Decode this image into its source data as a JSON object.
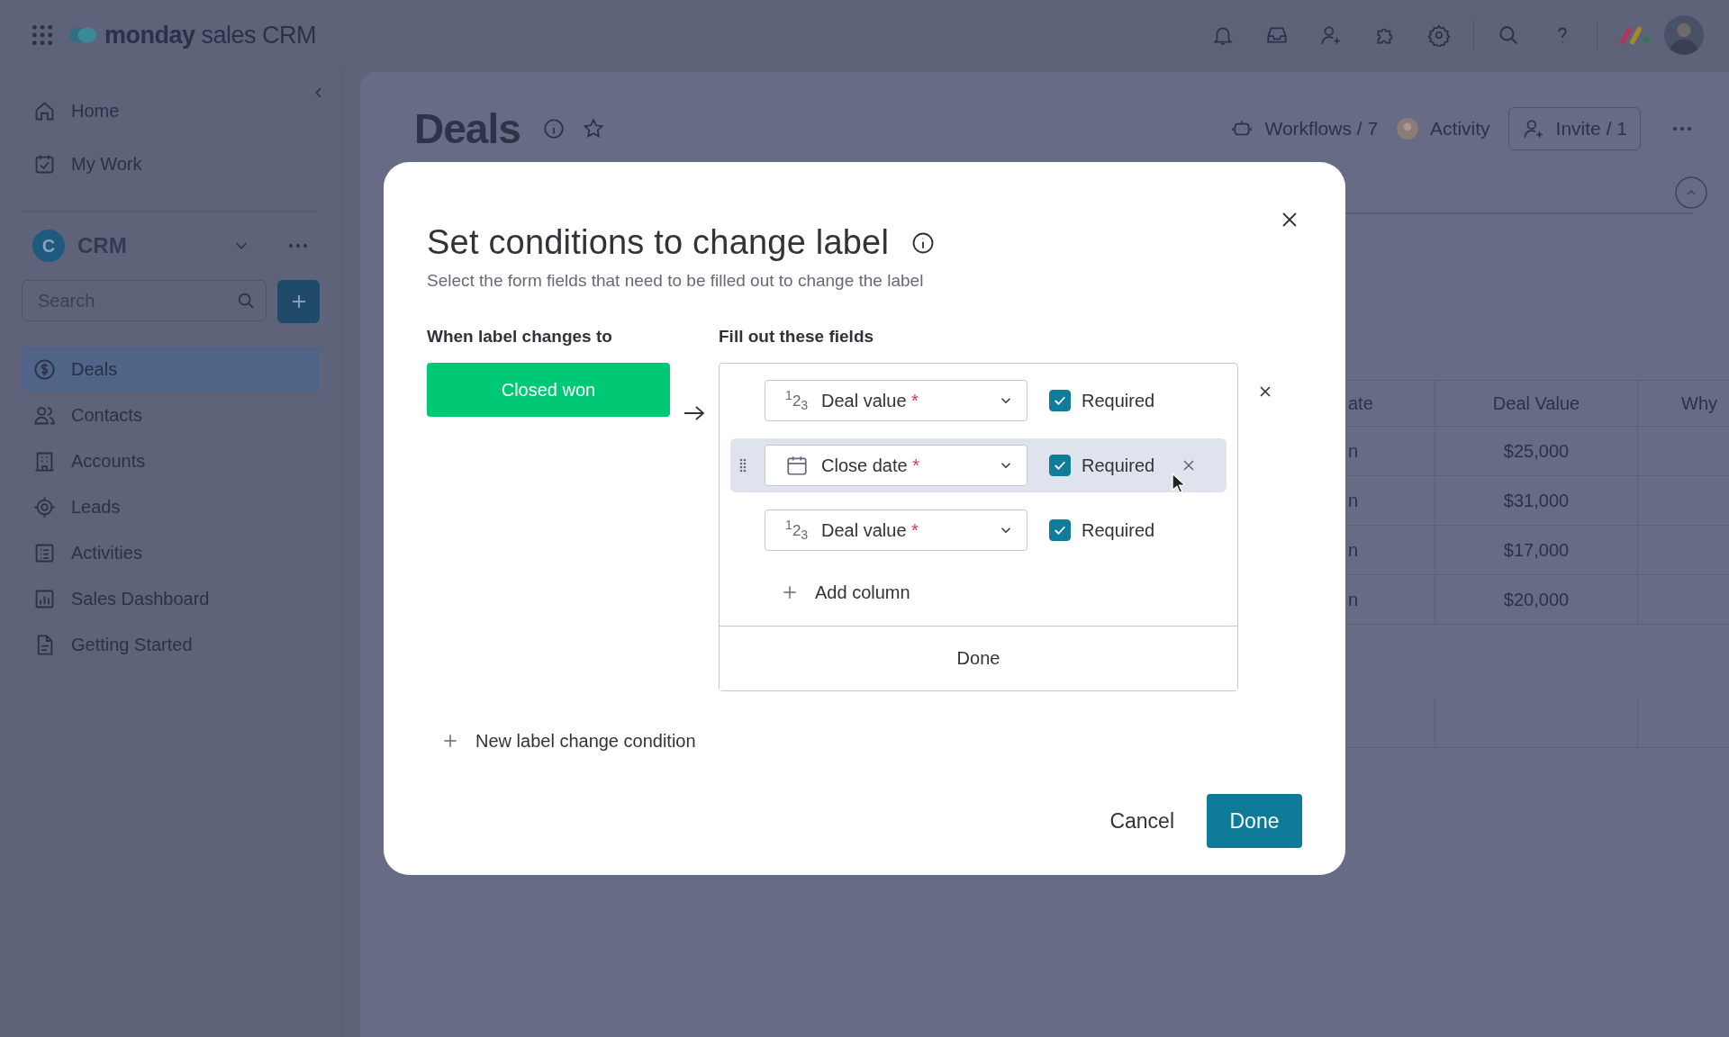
{
  "app_bar": {
    "logo_bold": "monday",
    "logo_rest": "sales CRM"
  },
  "sidebar": {
    "nav": [
      {
        "kind": "home",
        "label": "Home"
      },
      {
        "kind": "work",
        "label": "My Work"
      }
    ],
    "workspace": {
      "initial": "C",
      "name": "CRM"
    },
    "search": {
      "placeholder": "Search"
    },
    "items": [
      {
        "kind": "dollar",
        "label": "Deals",
        "selected": true
      },
      {
        "kind": "people",
        "label": "Contacts",
        "selected": false
      },
      {
        "kind": "building",
        "label": "Accounts",
        "selected": false
      },
      {
        "kind": "target",
        "label": "Leads",
        "selected": false
      },
      {
        "kind": "list",
        "label": "Activities",
        "selected": false
      },
      {
        "kind": "chart",
        "label": "Sales Dashboard",
        "selected": false
      },
      {
        "kind": "doc",
        "label": "Getting Started",
        "selected": false
      }
    ]
  },
  "board": {
    "title": "Deals",
    "workflows": "Workflows / 7",
    "activity": "Activity",
    "invite": "Invite / 1",
    "table": {
      "columns": [
        "ate",
        "Deal Value",
        "Why"
      ],
      "rows": [
        {
          "column_1": "n",
          "deal_value": "$25,000"
        },
        {
          "column_1": "n",
          "deal_value": "$31,000"
        },
        {
          "column_1": "n",
          "deal_value": "$17,000"
        },
        {
          "column_1": "n",
          "deal_value": "$20,000"
        }
      ]
    }
  },
  "modal": {
    "title": "Set conditions to change label",
    "subtitle": "Select the form fields that need to be filled out to change the label",
    "left_heading": "When label changes to",
    "right_heading": "Fill out these fields",
    "label": {
      "text": "Closed won",
      "color": "#00c875"
    },
    "fields": [
      {
        "kind": "number",
        "icon_text": "$^{1}$2$_{3}$",
        "name": "Deal value",
        "mark": "*",
        "checkbox_label": "Required",
        "checked": true,
        "highlighted": false
      },
      {
        "kind": "date",
        "name": "Close date",
        "mark": "*",
        "checkbox_label": "Required",
        "checked": true,
        "highlighted": true
      },
      {
        "kind": "number",
        "icon_text": "$^{1}$2$_{3}$",
        "name": "Deal value",
        "mark": "*",
        "checkbox_label": "Required",
        "checked": true,
        "highlighted": false
      }
    ],
    "add_column": "Add column",
    "inner_done": "Done",
    "new_condition": "New label change condition",
    "cancel": "Cancel",
    "done": "Done"
  }
}
